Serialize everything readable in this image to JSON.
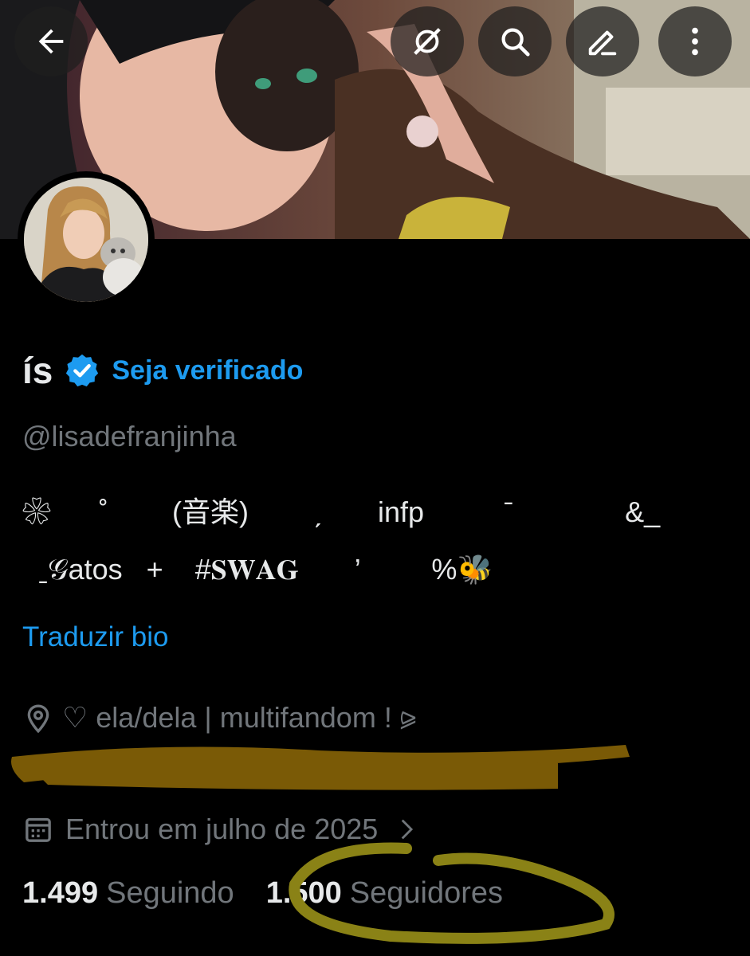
{
  "topbar": {
    "back_icon": "arrow-left-icon",
    "grok_icon": "grok-icon",
    "search_icon": "search-icon",
    "edit_icon": "pencil-icon",
    "more_icon": "more-vertical-icon"
  },
  "profile": {
    "display_name": "ís",
    "verify_link": "Seja verificado",
    "handle": "@lisadefranjinha",
    "bio_line1": "❀      ˚        (音楽)        ˏ       infp          ˉ              &_",
    "bio_line2": "  ˍ𝒢atos   +    #𝐒𝐖𝐀𝐆       ’         %🐝",
    "translate_label": "Traduzir bio",
    "location": "♡ ela/dela | multifandom  ! ⪩",
    "joined": "Entrou em julho de 2025",
    "following_count": "1.499",
    "following_label": "Seguindo",
    "followers_count": "1.500",
    "followers_label": "Seguidores"
  },
  "colors": {
    "accent": "#1d9bf0",
    "secondary_text": "#71767b",
    "scribble": "#7a5a06",
    "circle_annotation": "#8a8216"
  }
}
